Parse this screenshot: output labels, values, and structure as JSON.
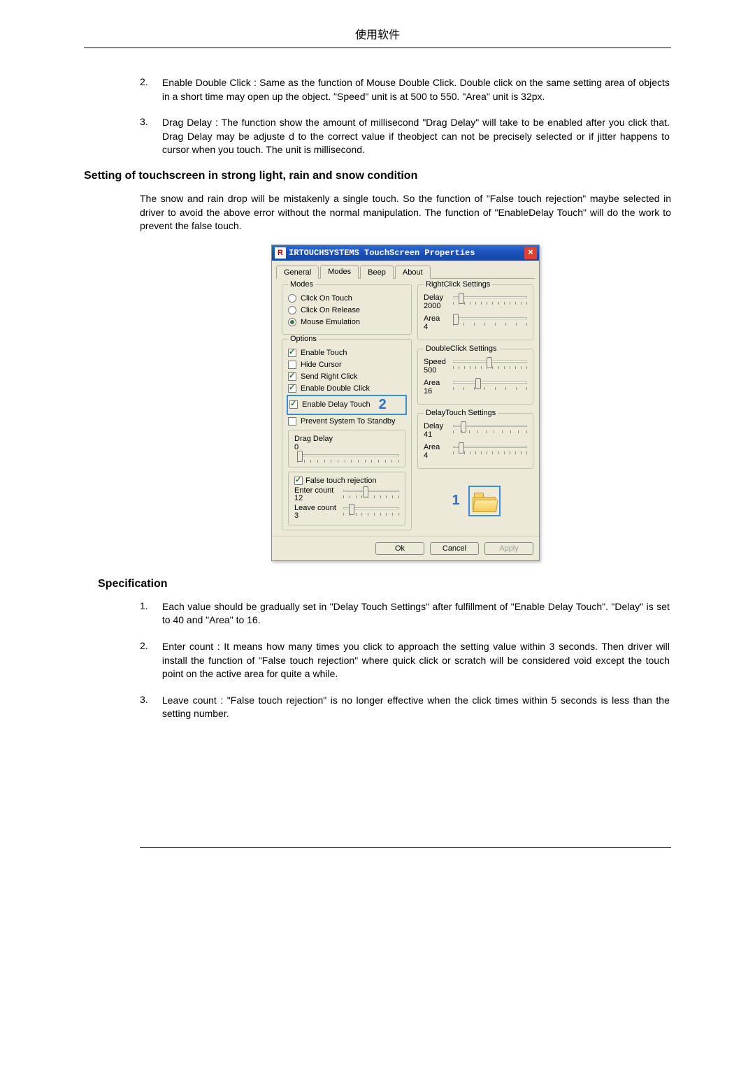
{
  "page_header": "使用软件",
  "body": {
    "list1": [
      {
        "num": "2.",
        "text": "Enable Double Click : Same as the function of Mouse Double Click. Double click on the same setting area of objects in a short time may open up the object. \"Speed\" unit is at 500 to 550. \"Area\" unit is 32px."
      },
      {
        "num": "3.",
        "text": "Drag Delay : The function show the amount of millisecond \"Drag Delay\" will take to be enabled after you click that. Drag Delay may be adjuste d to the correct value if theobject can not be precisely selected or if jitter happens to cursor when you touch. The unit is millisecond."
      }
    ],
    "heading1": "Setting of touchscreen in strong light, rain and snow condition",
    "para1": "The snow and rain drop will be mistakenly a single touch. So the function of \"False touch rejection\" maybe selected in driver to avoid the above error without the normal manipulation. The function of \"EnableDelay Touch\" will do the work to prevent the false touch.",
    "heading2": "Specification",
    "list2": [
      {
        "num": "1.",
        "text": "Each value should be gradually set in \"Delay Touch Settings\" after fulfillment of \"Enable Delay Touch\". \"Delay\" is set to 40 and \"Area\" to 16."
      },
      {
        "num": "2.",
        "text": "Enter count : It means how many times you click to approach the setting value within 3 seconds. Then driver will install the function of \"False touch rejection\" where quick click or scratch will be considered void except the touch point on the active area for quite a while."
      },
      {
        "num": "3.",
        "text": "Leave count : \"False touch rejection\" is no longer effective when the click times within 5 seconds is less than the setting number."
      }
    ]
  },
  "dialog": {
    "title": "IRTOUCHSYSTEMS TouchScreen Properties",
    "title_icon": "R",
    "close_glyph": "×",
    "tabs": {
      "general": "General",
      "modes": "Modes",
      "beep": "Beep",
      "about": "About"
    },
    "modes": {
      "legend": "Modes",
      "click_on_touch": "Click On Touch",
      "click_on_release": "Click On Release",
      "mouse_emulation": "Mouse Emulation"
    },
    "options": {
      "legend": "Options",
      "enable_touch": "Enable Touch",
      "hide_cursor": "Hide Cursor",
      "send_right_click": "Send Right Click",
      "enable_double_click": "Enable Double Click",
      "enable_delay_touch": "Enable Delay Touch",
      "prevent_standby": "Prevent System To Standby"
    },
    "drag_delay": {
      "legend": "Drag Delay",
      "value": "0"
    },
    "false_touch": {
      "legend": "False touch rejection",
      "enter_label": "Enter count",
      "enter_value": "12",
      "leave_label": "Leave count",
      "leave_value": "3"
    },
    "rightclick": {
      "legend": "RightClick Settings",
      "delay_label": "Delay",
      "delay_value": "2000",
      "area_label": "Area",
      "area_value": "4"
    },
    "doubleclick": {
      "legend": "DoubleClick Settings",
      "speed_label": "Speed",
      "speed_value": "500",
      "area_label": "Area",
      "area_value": "16"
    },
    "delaytouch": {
      "legend": "DelayTouch Settings",
      "delay_label": "Delay",
      "delay_value": "41",
      "area_label": "Area",
      "area_value": "4"
    },
    "annot1": "1",
    "annot2": "2",
    "buttons": {
      "ok": "Ok",
      "cancel": "Cancel",
      "apply": "Apply"
    }
  }
}
